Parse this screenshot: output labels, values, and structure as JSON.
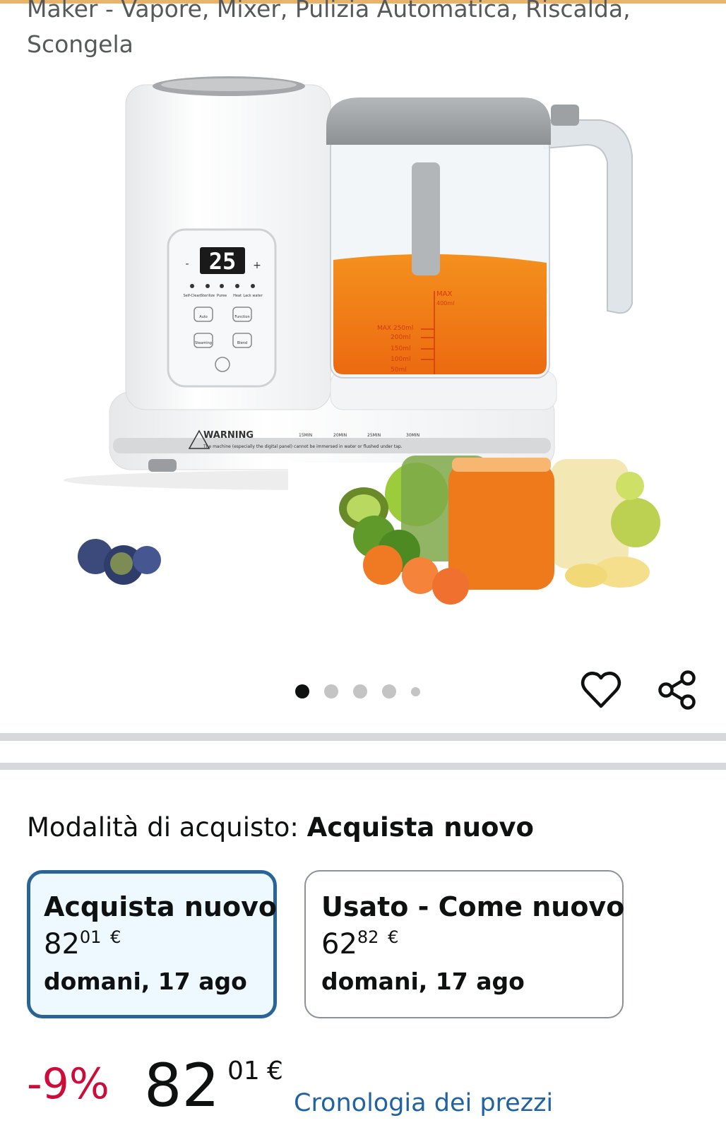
{
  "product": {
    "title_line1": "Maker - Vapore, Mixer, Pulizia Automatica, Riscalda,",
    "title_line2": "Scongela",
    "image_icon": "baby-food-maker-image"
  },
  "device_panel": {
    "display": "25",
    "minus": "-",
    "plus": "+",
    "button_labels": [
      "Auto",
      "Function",
      "Steaming",
      "Blend"
    ],
    "mode_labels": [
      "Self-Clean",
      "Sterilize",
      "Puree",
      "Heat",
      "Lack water"
    ]
  },
  "device_base": {
    "warning_title": "WARNING",
    "warning_text": "The machine (especially the digital panel) cannot be immersed in water or flushed under tap.",
    "timers": [
      "15MIN",
      "20MIN",
      "25MIN",
      "30MIN"
    ]
  },
  "jar_markings": {
    "max": "MAX",
    "max_ml": "400ml",
    "levels": [
      "MAX 250ml",
      "200ml",
      "150ml",
      "100ml",
      "50ml"
    ]
  },
  "carousel": {
    "count": 5,
    "active_index": 0
  },
  "actions": {
    "wishlist_icon": "heart-icon",
    "share_icon": "share-icon"
  },
  "purchase_mode": {
    "label": "Modalità di acquisto:",
    "value": "Acquista nuovo"
  },
  "options": [
    {
      "title": "Acquista nuovo",
      "price_whole": "82",
      "price_cents": "01",
      "currency": "€",
      "delivery": "domani, 17 ago",
      "selected": true
    },
    {
      "title": "Usato - Come nuovo",
      "price_whole": "62",
      "price_cents": "82",
      "currency": "€",
      "delivery": "domani, 17 ago",
      "selected": false
    }
  ],
  "price": {
    "discount": "-9%",
    "whole": "82",
    "cents": "01",
    "currency": "€",
    "history_link": "Cronologia dei prezzi"
  },
  "colors": {
    "accent_top": "#e9b46a",
    "selected_border": "#2a6496",
    "selected_bg": "#edf8ff",
    "discount_red": "#cc0c39",
    "link_blue": "#2162a1"
  }
}
